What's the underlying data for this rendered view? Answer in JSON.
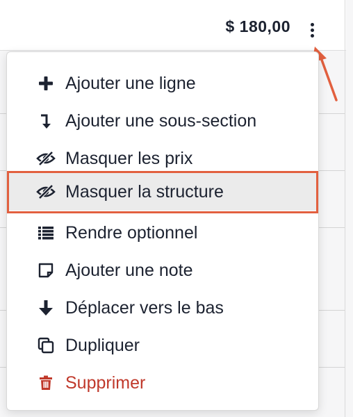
{
  "header": {
    "total": "$ 180,00"
  },
  "menu": {
    "items": [
      {
        "label": "Ajouter une ligne",
        "icon": "plus-icon"
      },
      {
        "label": "Ajouter une sous-section",
        "icon": "turn-down-arrow-icon"
      },
      {
        "label": "Masquer les prix",
        "icon": "eye-slash-icon"
      },
      {
        "label": "Masquer la structure",
        "icon": "eye-slash-icon"
      },
      {
        "label": "Rendre optionnel",
        "icon": "list-icon"
      },
      {
        "label": "Ajouter une note",
        "icon": "note-icon"
      },
      {
        "label": "Déplacer vers le bas",
        "icon": "arrow-down-icon"
      },
      {
        "label": "Dupliquer",
        "icon": "copy-icon"
      },
      {
        "label": "Supprimer",
        "icon": "trash-icon"
      }
    ],
    "highlighted_item": "Masquer la structure"
  },
  "colors": {
    "text": "#1c2230",
    "danger": "#c0392b",
    "annotation": "#e2603f",
    "highlight_bg": "#ebebeb"
  }
}
